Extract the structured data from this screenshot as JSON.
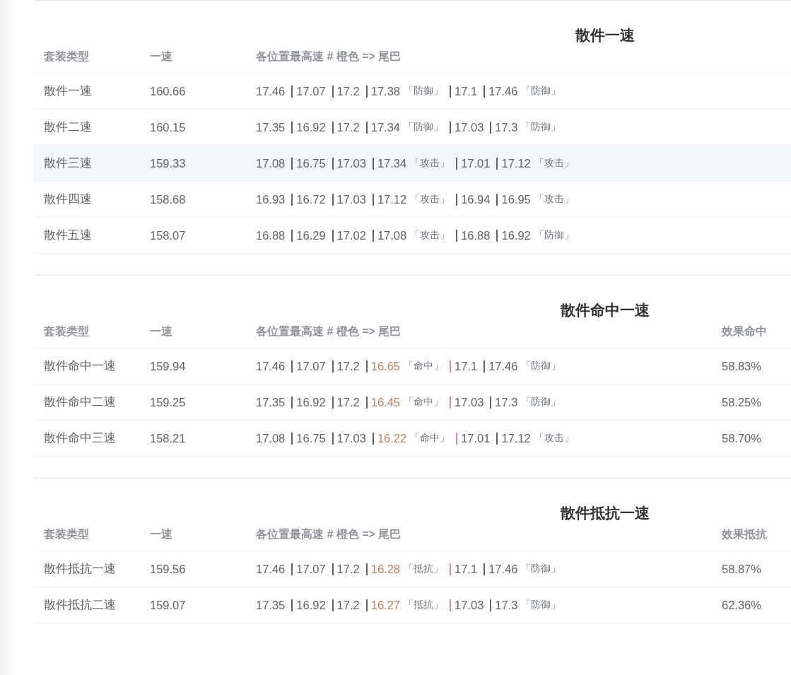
{
  "sections": [
    {
      "title": "散件一速",
      "columns": [
        "套装类型",
        "一速",
        "各位置最高速 # 橙色 => 尾巴"
      ],
      "rows": [
        {
          "hovered": false,
          "name": "散件一速",
          "speed": "160.66",
          "segments": [
            {
              "value": "17.46",
              "highlight": false
            },
            {
              "value": "17.07",
              "highlight": false
            },
            {
              "value": "17.2",
              "highlight": false
            },
            {
              "value": "17.38",
              "tag": "「防御」",
              "highlight": false
            },
            {
              "value": "17.1",
              "highlight": false
            },
            {
              "value": "17.46",
              "tag": "「防御」",
              "highlight": false
            }
          ]
        },
        {
          "hovered": false,
          "name": "散件二速",
          "speed": "160.15",
          "segments": [
            {
              "value": "17.35",
              "highlight": false
            },
            {
              "value": "16.92",
              "highlight": false
            },
            {
              "value": "17.2",
              "highlight": false
            },
            {
              "value": "17.34",
              "tag": "「防御」",
              "highlight": false
            },
            {
              "value": "17.03",
              "highlight": false
            },
            {
              "value": "17.3",
              "tag": "「防御」",
              "highlight": false
            }
          ]
        },
        {
          "hovered": true,
          "name": "散件三速",
          "speed": "159.33",
          "segments": [
            {
              "value": "17.08",
              "highlight": false
            },
            {
              "value": "16.75",
              "highlight": false
            },
            {
              "value": "17.03",
              "highlight": false
            },
            {
              "value": "17.34",
              "tag": "「攻击」",
              "highlight": false
            },
            {
              "value": "17.01",
              "highlight": false
            },
            {
              "value": "17.12",
              "tag": "「攻击」",
              "highlight": false
            }
          ]
        },
        {
          "hovered": false,
          "name": "散件四速",
          "speed": "158.68",
          "segments": [
            {
              "value": "16.93",
              "highlight": false
            },
            {
              "value": "16.72",
              "highlight": false
            },
            {
              "value": "17.03",
              "highlight": false
            },
            {
              "value": "17.12",
              "tag": "「攻击」",
              "highlight": false
            },
            {
              "value": "16.94",
              "highlight": false
            },
            {
              "value": "16.95",
              "tag": "「攻击」",
              "highlight": false
            }
          ]
        },
        {
          "hovered": false,
          "name": "散件五速",
          "speed": "158.07",
          "segments": [
            {
              "value": "16.88",
              "highlight": false
            },
            {
              "value": "16.29",
              "highlight": false
            },
            {
              "value": "17.02",
              "highlight": false
            },
            {
              "value": "17.08",
              "tag": "「攻击」",
              "highlight": false
            },
            {
              "value": "16.88",
              "highlight": false
            },
            {
              "value": "16.92",
              "tag": "「防御」",
              "highlight": false
            }
          ]
        }
      ]
    },
    {
      "title": "散件命中一速",
      "columns": [
        "套装类型",
        "一速",
        "各位置最高速 # 橙色 => 尾巴",
        "效果命中"
      ],
      "rows": [
        {
          "hovered": false,
          "name": "散件命中一速",
          "speed": "159.94",
          "segments": [
            {
              "value": "17.46",
              "highlight": false
            },
            {
              "value": "17.07",
              "highlight": false
            },
            {
              "value": "17.2",
              "highlight": false
            },
            {
              "value": "16.65",
              "tag": "「命中」",
              "highlight": true
            },
            {
              "value": "17.1",
              "highlight": false
            },
            {
              "value": "17.46",
              "tag": "「防御」",
              "highlight": false
            }
          ],
          "extra": "58.83%"
        },
        {
          "hovered": false,
          "name": "散件命中二速",
          "speed": "159.25",
          "segments": [
            {
              "value": "17.35",
              "highlight": false
            },
            {
              "value": "16.92",
              "highlight": false
            },
            {
              "value": "17.2",
              "highlight": false
            },
            {
              "value": "16.45",
              "tag": "「命中」",
              "highlight": true
            },
            {
              "value": "17.03",
              "highlight": false
            },
            {
              "value": "17.3",
              "tag": "「防御」",
              "highlight": false
            }
          ],
          "extra": "58.25%"
        },
        {
          "hovered": false,
          "name": "散件命中三速",
          "speed": "158.21",
          "segments": [
            {
              "value": "17.08",
              "highlight": false
            },
            {
              "value": "16.75",
              "highlight": false
            },
            {
              "value": "17.03",
              "highlight": false
            },
            {
              "value": "16.22",
              "tag": "「命中」",
              "highlight": true
            },
            {
              "value": "17.01",
              "highlight": false
            },
            {
              "value": "17.12",
              "tag": "「攻击」",
              "highlight": false
            }
          ],
          "extra": "58.70%"
        }
      ]
    },
    {
      "title": "散件抵抗一速",
      "columns": [
        "套装类型",
        "一速",
        "各位置最高速 # 橙色 => 尾巴",
        "效果抵抗"
      ],
      "rows": [
        {
          "hovered": false,
          "name": "散件抵抗一速",
          "speed": "159.56",
          "segments": [
            {
              "value": "17.46",
              "highlight": false
            },
            {
              "value": "17.07",
              "highlight": false
            },
            {
              "value": "17.2",
              "highlight": false
            },
            {
              "value": "16.28",
              "tag": "「抵抗」",
              "highlight": true
            },
            {
              "value": "17.1",
              "highlight": false
            },
            {
              "value": "17.46",
              "tag": "「防御」",
              "highlight": false
            }
          ],
          "extra": "58.87%"
        },
        {
          "hovered": false,
          "name": "散件抵抗二速",
          "speed": "159.07",
          "segments": [
            {
              "value": "17.35",
              "highlight": false
            },
            {
              "value": "16.92",
              "highlight": false
            },
            {
              "value": "17.2",
              "highlight": false
            },
            {
              "value": "16.27",
              "tag": "「抵抗」",
              "highlight": true
            },
            {
              "value": "17.03",
              "highlight": false
            },
            {
              "value": "17.3",
              "tag": "「防御」",
              "highlight": false
            }
          ],
          "extra": "62.36%"
        }
      ]
    }
  ]
}
